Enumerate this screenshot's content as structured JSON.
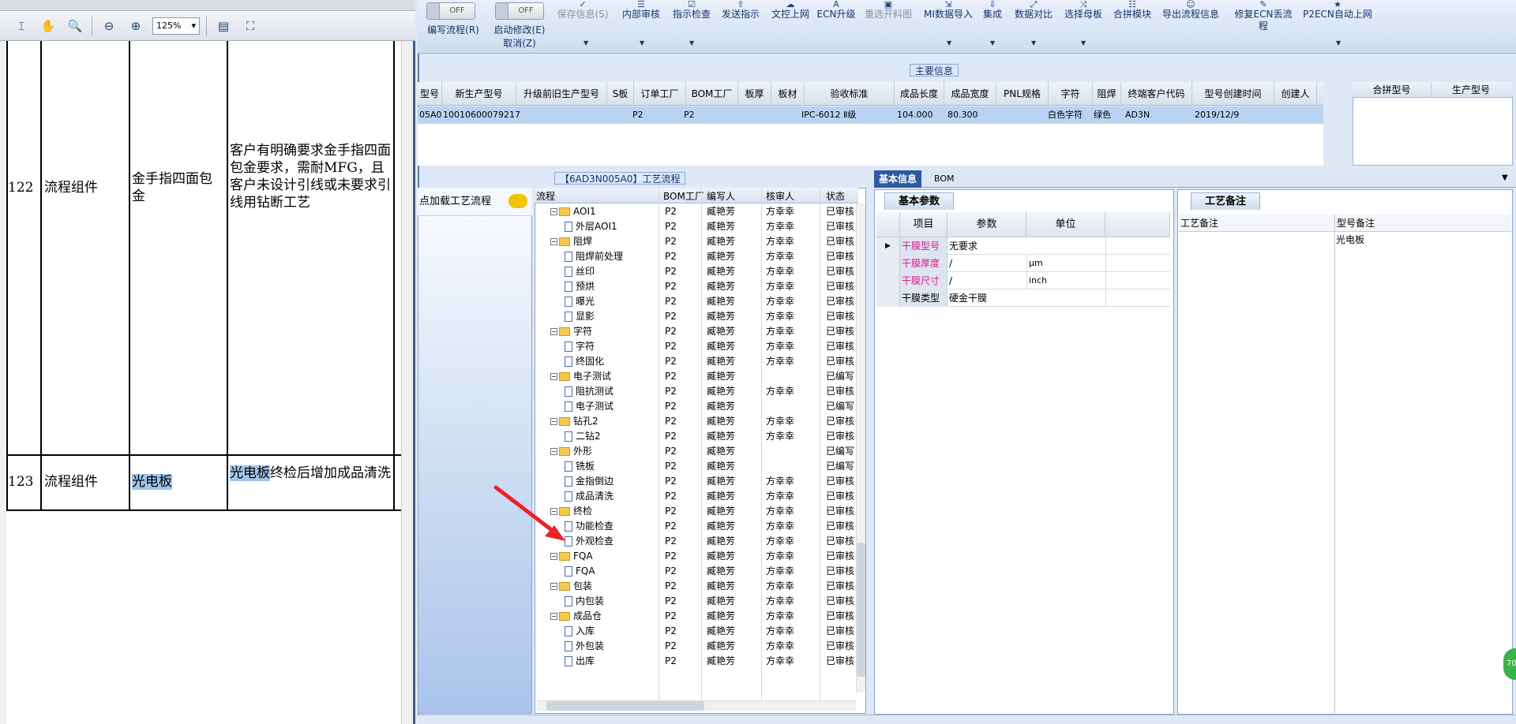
{
  "pdf": {
    "zoom": "125%",
    "tools": [
      "select-icon",
      "hand-icon",
      "zoom-icon",
      "zoom-out-icon",
      "zoom-in-icon",
      "fit-page-icon",
      "full-screen-icon"
    ],
    "rows": [
      {
        "num": "122",
        "cat": "流程组件",
        "item": "金手指四面包金",
        "desc": "客户有明确要求金手指四面包金要求，需耐MFG，且客户未设计引线或未要求引线用钻断工艺"
      },
      {
        "num": "123",
        "cat": "流程组件",
        "item": "光电板",
        "desc_hl": "光电板",
        "desc_rest": "终检后增加成品清洗"
      }
    ]
  },
  "ribbon": {
    "toggle_off": "OFF",
    "buttons": [
      "编写流程(R)",
      "启动修改(E)",
      "取消(Z)",
      "保存信息(S)",
      "内部审核",
      "指示检查",
      "发送指示",
      "文控上网",
      "ECN升级",
      "重选开料图",
      "MI数据导入",
      "集成",
      "数据对比",
      "选择母板",
      "合拼模块",
      "导出流程信息",
      "修复ECN丢流程",
      "P2ECN自动上网"
    ]
  },
  "main": {
    "title": "主要信息",
    "headers": [
      "型号",
      "新生产型号",
      "升级前旧生产型号",
      "S板",
      "订单工厂",
      "BOM工厂",
      "板厚",
      "板材",
      "验收标准",
      "成品长度",
      "成品宽度",
      "PNL规格",
      "字符",
      "阻焊",
      "终端客户代码",
      "型号创建时间",
      "创建人"
    ],
    "row": [
      "05A0",
      "10010600079217",
      "",
      "",
      "P2",
      "P2",
      "",
      "",
      "IPC-6012 Ⅱ级",
      "104.000",
      "80.300",
      "",
      "白色字符",
      "绿色",
      "AD3N",
      "2019/12/9",
      ""
    ],
    "combo_headers": [
      "合拼型号",
      "生产型号"
    ]
  },
  "flow": {
    "title": "【6AD3N005A0】工艺流程",
    "load_label": "点加载工艺流程",
    "headers": [
      "流程",
      "BOM工厂",
      "编写人",
      "核审人",
      "状态"
    ],
    "rows": [
      {
        "t": "folder",
        "name": "AOI1",
        "f": "P2",
        "w": "臧艳芳",
        "r": "方幸幸",
        "s": "已审核"
      },
      {
        "t": "doc",
        "name": "外层AOI1",
        "f": "P2",
        "w": "臧艳芳",
        "r": "方幸幸",
        "s": "已审核"
      },
      {
        "t": "folder",
        "name": "阻焊",
        "f": "P2",
        "w": "臧艳芳",
        "r": "方幸幸",
        "s": "已审核"
      },
      {
        "t": "doc",
        "name": "阻焊前处理",
        "f": "P2",
        "w": "臧艳芳",
        "r": "方幸幸",
        "s": "已审核"
      },
      {
        "t": "doc",
        "name": "丝印",
        "f": "P2",
        "w": "臧艳芳",
        "r": "方幸幸",
        "s": "已审核"
      },
      {
        "t": "doc",
        "name": "预烘",
        "f": "P2",
        "w": "臧艳芳",
        "r": "方幸幸",
        "s": "已审核"
      },
      {
        "t": "doc",
        "name": "曝光",
        "f": "P2",
        "w": "臧艳芳",
        "r": "方幸幸",
        "s": "已审核"
      },
      {
        "t": "doc",
        "name": "显影",
        "f": "P2",
        "w": "臧艳芳",
        "r": "方幸幸",
        "s": "已审核"
      },
      {
        "t": "folder",
        "name": "字符",
        "f": "P2",
        "w": "臧艳芳",
        "r": "方幸幸",
        "s": "已审核"
      },
      {
        "t": "doc",
        "name": "字符",
        "f": "P2",
        "w": "臧艳芳",
        "r": "方幸幸",
        "s": "已审核"
      },
      {
        "t": "doc",
        "name": "终固化",
        "f": "P2",
        "w": "臧艳芳",
        "r": "方幸幸",
        "s": "已审核"
      },
      {
        "t": "folder",
        "name": "电子测试",
        "f": "P2",
        "w": "臧艳芳",
        "r": "",
        "s": "已编写"
      },
      {
        "t": "doc",
        "name": "阻抗测试",
        "f": "P2",
        "w": "臧艳芳",
        "r": "方幸幸",
        "s": "已审核"
      },
      {
        "t": "doc",
        "name": "电子测试",
        "f": "P2",
        "w": "臧艳芳",
        "r": "",
        "s": "已编写"
      },
      {
        "t": "folder",
        "name": "钻孔2",
        "f": "P2",
        "w": "臧艳芳",
        "r": "方幸幸",
        "s": "已审核"
      },
      {
        "t": "doc",
        "name": "二钻2",
        "f": "P2",
        "w": "臧艳芳",
        "r": "方幸幸",
        "s": "已审核"
      },
      {
        "t": "folder",
        "name": "外形",
        "f": "P2",
        "w": "臧艳芳",
        "r": "",
        "s": "已编写"
      },
      {
        "t": "doc",
        "name": "铣板",
        "f": "P2",
        "w": "臧艳芳",
        "r": "",
        "s": "已编写"
      },
      {
        "t": "doc",
        "name": "金指倒边",
        "f": "P2",
        "w": "臧艳芳",
        "r": "方幸幸",
        "s": "已审核"
      },
      {
        "t": "doc",
        "name": "成品清洗",
        "f": "P2",
        "w": "臧艳芳",
        "r": "方幸幸",
        "s": "已审核"
      },
      {
        "t": "folder",
        "name": "终检",
        "f": "P2",
        "w": "臧艳芳",
        "r": "方幸幸",
        "s": "已审核"
      },
      {
        "t": "doc",
        "name": "功能检查",
        "f": "P2",
        "w": "臧艳芳",
        "r": "方幸幸",
        "s": "已审核"
      },
      {
        "t": "doc",
        "name": "外观检查",
        "f": "P2",
        "w": "臧艳芳",
        "r": "方幸幸",
        "s": "已审核"
      },
      {
        "t": "folder",
        "name": "FQA",
        "f": "P2",
        "w": "臧艳芳",
        "r": "方幸幸",
        "s": "已审核"
      },
      {
        "t": "doc",
        "name": "FQA",
        "f": "P2",
        "w": "臧艳芳",
        "r": "方幸幸",
        "s": "已审核"
      },
      {
        "t": "folder",
        "name": "包装",
        "f": "P2",
        "w": "臧艳芳",
        "r": "方幸幸",
        "s": "已审核"
      },
      {
        "t": "doc",
        "name": "内包装",
        "f": "P2",
        "w": "臧艳芳",
        "r": "方幸幸",
        "s": "已审核"
      },
      {
        "t": "folder",
        "name": "成品仓",
        "f": "P2",
        "w": "臧艳芳",
        "r": "方幸幸",
        "s": "已审核"
      },
      {
        "t": "doc",
        "name": "入库",
        "f": "P2",
        "w": "臧艳芳",
        "r": "方幸幸",
        "s": "已审核"
      },
      {
        "t": "doc",
        "name": "外包装",
        "f": "P2",
        "w": "臧艳芳",
        "r": "方幸幸",
        "s": "已审核"
      },
      {
        "t": "doc",
        "name": "出库",
        "f": "P2",
        "w": "臧艳芳",
        "r": "方幸幸",
        "s": "已审核"
      }
    ]
  },
  "info": {
    "tabs": [
      "基本信息",
      "BOM"
    ],
    "subtab": "基本参数",
    "headers": [
      "项目",
      "参数",
      "单位"
    ],
    "rows": [
      {
        "item": "干膜型号",
        "param": "无要求",
        "unit": "",
        "pink": true
      },
      {
        "item": "干膜厚度",
        "param": "/",
        "unit": "μm",
        "pink": true
      },
      {
        "item": "干膜尺寸",
        "param": "/",
        "unit": "inch",
        "pink": true
      },
      {
        "item": "干膜类型",
        "param": "硬金干膜",
        "unit": "",
        "pink": false
      }
    ]
  },
  "notes": {
    "subtab": "工艺备注",
    "headers": [
      "工艺备注",
      "型号备注"
    ],
    "model_note": "光电板"
  },
  "badge": "70",
  "colors": {
    "accent": "#1f3f7a",
    "highlight": "#9fc3ea",
    "selected_row": "#b9d4f2",
    "pink_label": "#e0198a",
    "arrow": "#e8232a"
  }
}
